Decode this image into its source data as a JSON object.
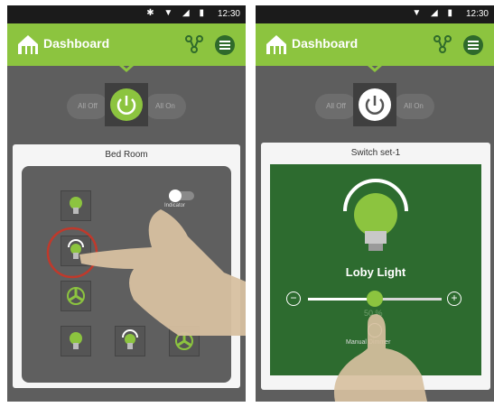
{
  "left": {
    "status": {
      "time": "12:30",
      "icons": "✱ ▼ ◢ ▮"
    },
    "appbar": {
      "title": "Dashboard"
    },
    "controls": {
      "all_off": "All Off",
      "all_on": "All On"
    },
    "panel": {
      "title": "Bed Room",
      "indicator_label": "Indicator"
    }
  },
  "right": {
    "status": {
      "time": "12:30",
      "icons": "▼ ◢ ▮"
    },
    "appbar": {
      "title": "Dashboard"
    },
    "controls": {
      "all_off": "All Off",
      "all_on": "All On"
    },
    "panel": {
      "title": "Switch set-1",
      "light_name": "Loby Light",
      "dim_value": "50 %",
      "dim_level": 0.5,
      "minus": "−",
      "plus": "+",
      "manual_dimmer": "Manual Dimmer"
    }
  },
  "colors": {
    "accent": "#8cc43f",
    "dark_green": "#2d6b2f",
    "status": "#1b1b1b"
  }
}
